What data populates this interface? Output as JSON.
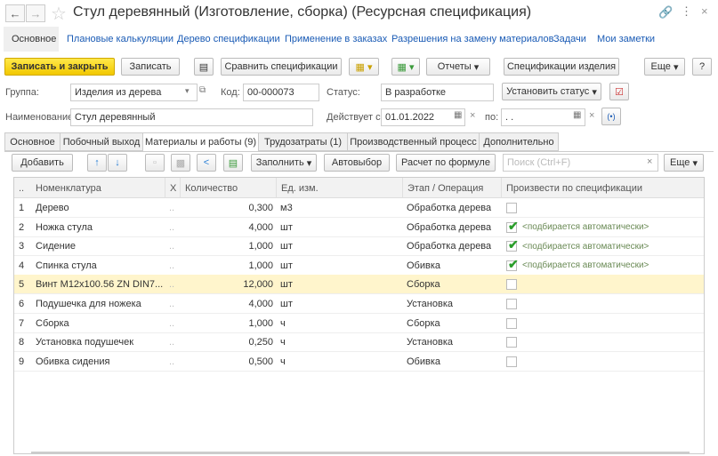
{
  "window": {
    "title": "Стул деревянный (Изготовление, сборка) (Ресурсная спецификация)"
  },
  "nav_links": [
    "Основное",
    "Плановые калькуляции",
    "Дерево спецификации",
    "Применение в заказах",
    "Разрешения на замену материалов",
    "Задачи",
    "Мои заметки"
  ],
  "toolbar": {
    "save_close": "Записать и закрыть",
    "save": "Записать",
    "compare": "Сравнить спецификации",
    "reports": "Отчеты",
    "product_specs": "Спецификации изделия",
    "more": "Еще",
    "help": "?"
  },
  "form": {
    "group_label": "Группа:",
    "group_value": "Изделия из дерева",
    "code_label": "Код:",
    "code_value": "00-000073",
    "status_label": "Статус:",
    "status_value": "В разработке",
    "set_status": "Установить статус",
    "name_label": "Наименование:",
    "name_value": "Стул деревянный",
    "valid_from_label": "Действует с:",
    "valid_from_value": "01.01.2022",
    "valid_to_label": "по:",
    "valid_to_value": " .  ."
  },
  "tabs": [
    "Основное",
    "Побочный выход",
    "Материалы и работы (9)",
    "Трудозатраты (1)",
    "Производственный процесс",
    "Дополнительно"
  ],
  "table_toolbar": {
    "add": "Добавить",
    "fill": "Заполнить",
    "autoselect": "Автовыбор",
    "formula": "Расчет по формуле",
    "search_placeholder": "Поиск (Ctrl+F)",
    "more": "Еще"
  },
  "table": {
    "columns": [
      "..",
      "Номенклатура",
      "X",
      "Количество",
      "Ед. изм.",
      "Этап / Операция",
      "Произвести по спецификации"
    ],
    "rows": [
      {
        "n": "1",
        "name": "Дерево",
        "x": "..",
        "qty": "0,300",
        "unit": "м3",
        "stage": "Обработка дерева",
        "checked": false,
        "auto": ""
      },
      {
        "n": "2",
        "name": "Ножка стула",
        "x": "..",
        "qty": "4,000",
        "unit": "шт",
        "stage": "Обработка дерева",
        "checked": true,
        "auto": "<подбирается автоматически>"
      },
      {
        "n": "3",
        "name": "Сидение",
        "x": "..",
        "qty": "1,000",
        "unit": "шт",
        "stage": "Обработка дерева",
        "checked": true,
        "auto": "<подбирается автоматически>"
      },
      {
        "n": "4",
        "name": "Спинка стула",
        "x": "..",
        "qty": "1,000",
        "unit": "шт",
        "stage": "Обивка",
        "checked": true,
        "auto": "<подбирается автоматически>"
      },
      {
        "n": "5",
        "name": "Винт М12х100.56 ZN DIN7...",
        "x": "..",
        "qty": "12,000",
        "unit": "шт",
        "stage": "Сборка",
        "checked": false,
        "auto": "",
        "selected": true
      },
      {
        "n": "6",
        "name": "Подушечка для ножека",
        "x": "..",
        "qty": "4,000",
        "unit": "шт",
        "stage": "Установка",
        "checked": false,
        "auto": ""
      },
      {
        "n": "7",
        "name": "Сборка",
        "x": "..",
        "qty": "1,000",
        "unit": "ч",
        "stage": "Сборка",
        "checked": false,
        "auto": ""
      },
      {
        "n": "8",
        "name": "Установка подушечек",
        "x": "..",
        "qty": "0,250",
        "unit": "ч",
        "stage": "Установка",
        "checked": false,
        "auto": ""
      },
      {
        "n": "9",
        "name": "Обивка сидения",
        "x": "..",
        "qty": "0,500",
        "unit": "ч",
        "stage": "Обивка",
        "checked": false,
        "auto": ""
      }
    ]
  }
}
